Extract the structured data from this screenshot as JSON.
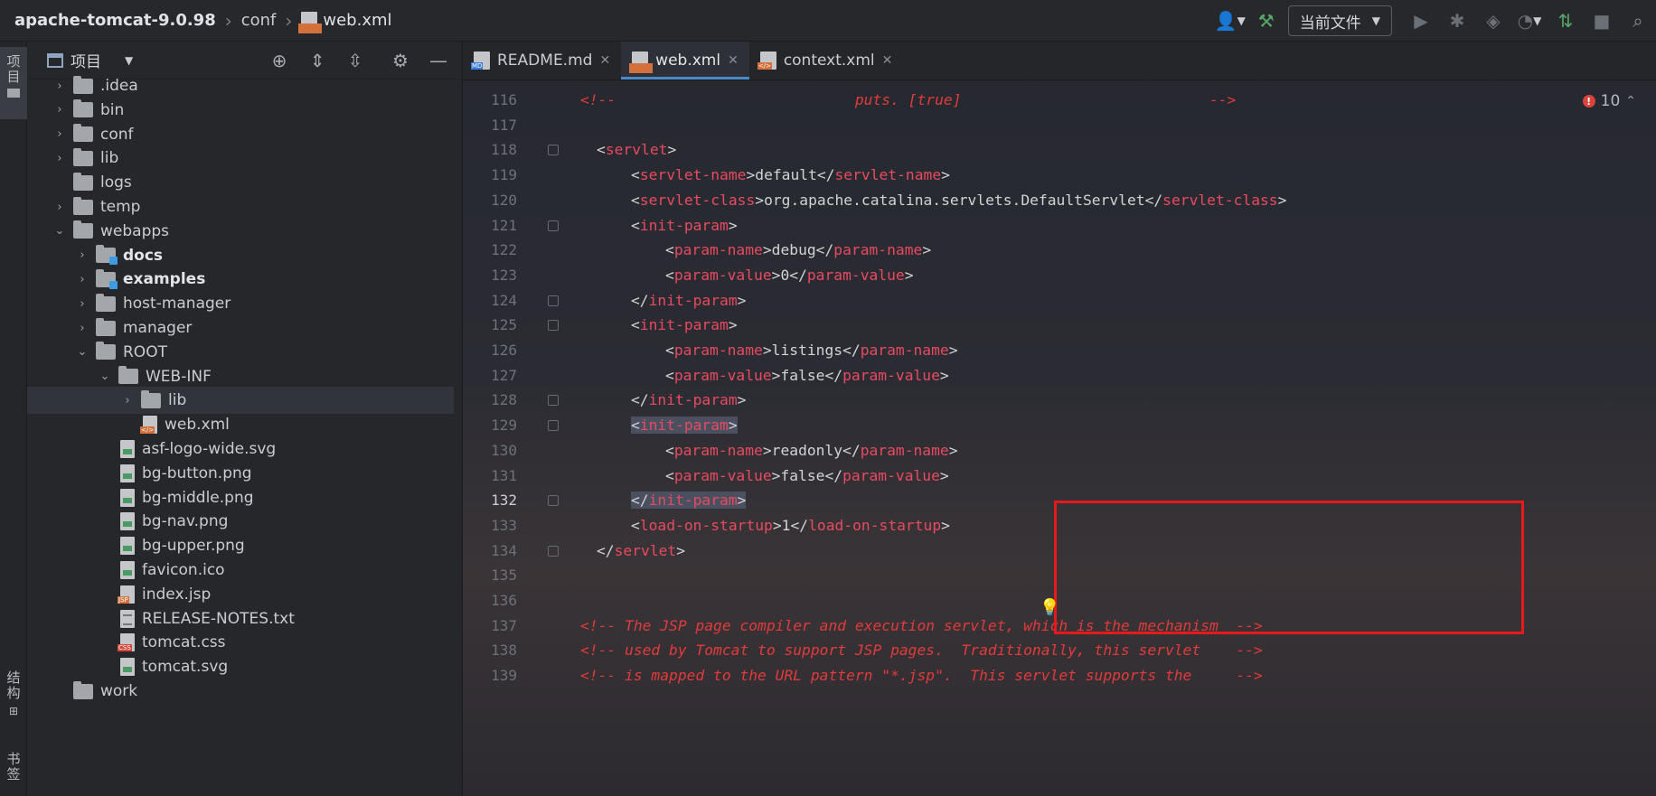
{
  "titlebar": {
    "project": "apache-tomcat-9.0.98",
    "folder": "conf",
    "file": "web.xml",
    "run_config": "当前文件"
  },
  "left_strip": {
    "project_tab": "项目",
    "structure_tab": "结构",
    "bookmarks_tab": "书签"
  },
  "project_panel": {
    "title": "项目",
    "tree": [
      {
        "label": ".idea",
        "kind": "folder",
        "depth": 1,
        "arrow": "›"
      },
      {
        "label": "bin",
        "kind": "folder",
        "depth": 1,
        "arrow": "›"
      },
      {
        "label": "conf",
        "kind": "folder",
        "depth": 1,
        "arrow": "›"
      },
      {
        "label": "lib",
        "kind": "folder",
        "depth": 1,
        "arrow": "›"
      },
      {
        "label": "logs",
        "kind": "folder",
        "depth": 1,
        "arrow": ""
      },
      {
        "label": "temp",
        "kind": "folder",
        "depth": 1,
        "arrow": "›"
      },
      {
        "label": "webapps",
        "kind": "folder",
        "depth": 1,
        "arrow": "⌄"
      },
      {
        "label": "docs",
        "kind": "webfolder",
        "depth": 2,
        "arrow": "›",
        "bold": true
      },
      {
        "label": "examples",
        "kind": "webfolder",
        "depth": 2,
        "arrow": "›",
        "bold": true
      },
      {
        "label": "host-manager",
        "kind": "folder",
        "depth": 2,
        "arrow": "›"
      },
      {
        "label": "manager",
        "kind": "folder",
        "depth": 2,
        "arrow": "›"
      },
      {
        "label": "ROOT",
        "kind": "folder",
        "depth": 2,
        "arrow": "⌄"
      },
      {
        "label": "WEB-INF",
        "kind": "folder",
        "depth": 3,
        "arrow": "⌄"
      },
      {
        "label": "lib",
        "kind": "folder",
        "depth": 4,
        "arrow": "›",
        "selected": true
      },
      {
        "label": "web.xml",
        "kind": "xml",
        "depth": 4,
        "arrow": ""
      },
      {
        "label": "asf-logo-wide.svg",
        "kind": "img",
        "depth": 3,
        "arrow": ""
      },
      {
        "label": "bg-button.png",
        "kind": "img",
        "depth": 3,
        "arrow": ""
      },
      {
        "label": "bg-middle.png",
        "kind": "img",
        "depth": 3,
        "arrow": ""
      },
      {
        "label": "bg-nav.png",
        "kind": "img",
        "depth": 3,
        "arrow": ""
      },
      {
        "label": "bg-upper.png",
        "kind": "img",
        "depth": 3,
        "arrow": ""
      },
      {
        "label": "favicon.ico",
        "kind": "img",
        "depth": 3,
        "arrow": ""
      },
      {
        "label": "index.jsp",
        "kind": "jsp",
        "depth": 3,
        "arrow": ""
      },
      {
        "label": "RELEASE-NOTES.txt",
        "kind": "txt",
        "depth": 3,
        "arrow": ""
      },
      {
        "label": "tomcat.css",
        "kind": "css",
        "depth": 3,
        "arrow": ""
      },
      {
        "label": "tomcat.svg",
        "kind": "img",
        "depth": 3,
        "arrow": ""
      },
      {
        "label": "work",
        "kind": "folder",
        "depth": 1,
        "arrow": ""
      }
    ]
  },
  "editor": {
    "tabs": [
      {
        "label": "README.md",
        "icon": "md",
        "active": false
      },
      {
        "label": "web.xml",
        "icon": "xml",
        "active": true
      },
      {
        "label": "context.xml",
        "icon": "xml",
        "active": false
      }
    ],
    "problems_count": "10",
    "current_line": "132",
    "lines": [
      {
        "n": "116",
        "type": "comment",
        "indent": 0,
        "text": "<!--                           puts. [true]                            -->"
      },
      {
        "n": "117",
        "type": "blank",
        "indent": 0,
        "text": ""
      },
      {
        "n": "118",
        "type": "open",
        "indent": 1,
        "tag": "servlet"
      },
      {
        "n": "119",
        "type": "elem",
        "indent": 2,
        "tag": "servlet-name",
        "value": "default"
      },
      {
        "n": "120",
        "type": "elem",
        "indent": 2,
        "tag": "servlet-class",
        "value": "org.apache.catalina.servlets.DefaultServlet"
      },
      {
        "n": "121",
        "type": "open",
        "indent": 2,
        "tag": "init-param"
      },
      {
        "n": "122",
        "type": "elem",
        "indent": 3,
        "tag": "param-name",
        "value": "debug"
      },
      {
        "n": "123",
        "type": "elem",
        "indent": 3,
        "tag": "param-value",
        "value": "0"
      },
      {
        "n": "124",
        "type": "close",
        "indent": 2,
        "tag": "init-param"
      },
      {
        "n": "125",
        "type": "open",
        "indent": 2,
        "tag": "init-param"
      },
      {
        "n": "126",
        "type": "elem",
        "indent": 3,
        "tag": "param-name",
        "value": "listings"
      },
      {
        "n": "127",
        "type": "elem",
        "indent": 3,
        "tag": "param-value",
        "value": "false"
      },
      {
        "n": "128",
        "type": "close",
        "indent": 2,
        "tag": "init-param"
      },
      {
        "n": "129",
        "type": "open",
        "indent": 2,
        "tag": "init-param",
        "hl": true
      },
      {
        "n": "130",
        "type": "elem",
        "indent": 3,
        "tag": "param-name",
        "value": "readonly"
      },
      {
        "n": "131",
        "type": "elem",
        "indent": 3,
        "tag": "param-value",
        "value": "false"
      },
      {
        "n": "132",
        "type": "close",
        "indent": 2,
        "tag": "init-param",
        "hl": true
      },
      {
        "n": "133",
        "type": "elem",
        "indent": 2,
        "tag": "load-on-startup",
        "value": "1"
      },
      {
        "n": "134",
        "type": "close",
        "indent": 1,
        "tag": "servlet"
      },
      {
        "n": "135",
        "type": "blank",
        "indent": 0,
        "text": ""
      },
      {
        "n": "136",
        "type": "blank",
        "indent": 0,
        "text": ""
      },
      {
        "n": "137",
        "type": "comment",
        "indent": 0,
        "text": "<!-- The JSP page compiler and execution servlet, which is the mechanism  -->"
      },
      {
        "n": "138",
        "type": "comment",
        "indent": 0,
        "text": "<!-- used by Tomcat to support JSP pages.  Traditionally, this servlet    -->"
      },
      {
        "n": "139",
        "type": "comment",
        "indent": 0,
        "text": "<!-- is mapped to the URL pattern \"*.jsp\".  This servlet supports the     -->"
      }
    ]
  },
  "colors": {
    "tag": "#e84a5f",
    "comment": "#e23b3b",
    "highlight_box": "#e6191b",
    "accent": "#4a88c7"
  }
}
